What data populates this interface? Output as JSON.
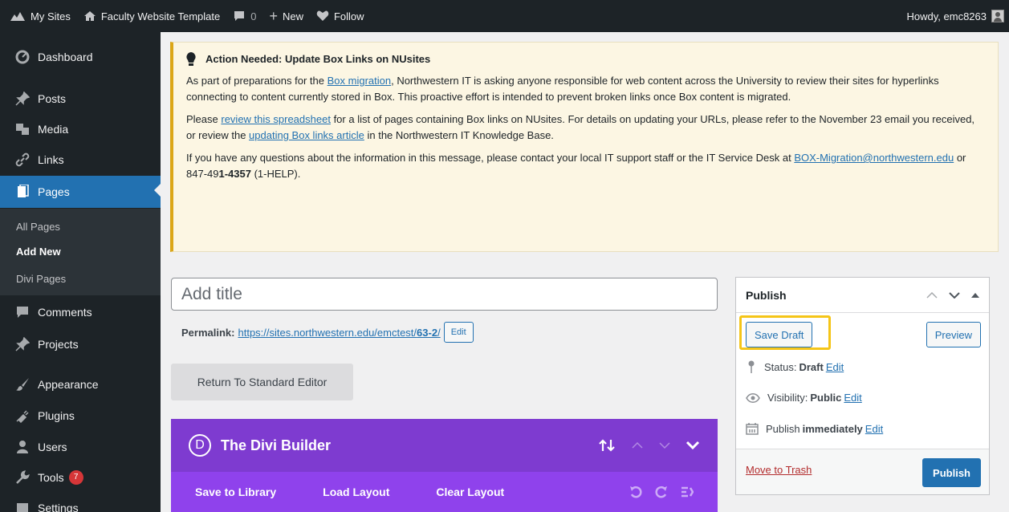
{
  "adminbar": {
    "my_sites": "My Sites",
    "site_name": "Faculty Website Template",
    "comments_count": "0",
    "new_label": "New",
    "follow_label": "Follow",
    "howdy": "Howdy, emc8263"
  },
  "sidebar": {
    "items": [
      {
        "label": "Dashboard",
        "icon": "dashboard-icon"
      },
      {
        "label": "Posts",
        "icon": "pin-icon"
      },
      {
        "label": "Media",
        "icon": "media-icon"
      },
      {
        "label": "Links",
        "icon": "link-icon"
      },
      {
        "label": "Pages",
        "icon": "page-icon"
      },
      {
        "label": "Comments",
        "icon": "comment-icon"
      },
      {
        "label": "Projects",
        "icon": "pin-icon"
      },
      {
        "label": "Appearance",
        "icon": "brush-icon"
      },
      {
        "label": "Plugins",
        "icon": "plugin-icon"
      },
      {
        "label": "Users",
        "icon": "user-icon"
      },
      {
        "label": "Tools",
        "icon": "wrench-icon",
        "badge": "7"
      },
      {
        "label": "Settings",
        "icon": "settings-icon"
      }
    ],
    "submenu": [
      "All Pages",
      "Add New",
      "Divi Pages"
    ]
  },
  "notice": {
    "title": "Action Needed: Update Box Links on NUsites",
    "p1_a": "As part of preparations for the ",
    "p1_link": "Box migration",
    "p1_b": ", Northwestern IT is asking anyone responsible for web content across the University to review their sites for hyperlinks connecting to content currently stored in Box. This proactive effort is intended to prevent broken links once Box content is migrated.",
    "p2_a": "Please ",
    "p2_link1": "review this spreadsheet",
    "p2_b": " for a list of pages containing Box links on NUsites. For details on updating your URLs, please refer to the November 23 email you received, or review the ",
    "p2_link2": "updating Box links article",
    "p2_c": " in the Northwestern IT Knowledge Base.",
    "p3_a": "If you have any questions about the information in this message, please contact your local IT support staff or the IT Service Desk at ",
    "p3_link": "BOX-Migration@northwestern.edu",
    "p3_b": " or 847-49",
    "p3_bold": "1-4357",
    "p3_c": " (1-HELP)."
  },
  "editor": {
    "title_placeholder": "Add title",
    "permalink_label": "Permalink:",
    "permalink_url": "https://sites.northwestern.edu/emctest/",
    "permalink_slug": "63-2",
    "permalink_end": "/",
    "edit_label": "Edit",
    "std_editor_label": "Return To Standard Editor"
  },
  "divi": {
    "logo_letter": "D",
    "title": "The Divi Builder",
    "bar": [
      "Save to Library",
      "Load Layout",
      "Clear Layout"
    ]
  },
  "publish": {
    "title": "Publish",
    "save_draft": "Save Draft",
    "preview": "Preview",
    "status_label": "Status:",
    "status_value": "Draft",
    "visibility_label": "Visibility:",
    "visibility_value": "Public",
    "publish_label": "Publish",
    "publish_value": "immediately",
    "edit": "Edit",
    "trash": "Move to Trash",
    "publish_button": "Publish"
  },
  "colors": {
    "admin_dark": "#1d2327",
    "accent_blue": "#2271b1",
    "notice_bg": "#fcf6e3",
    "notice_border": "#dba617",
    "divi_purple": "#7e3bd0",
    "highlight": "#f5c518",
    "trash_red": "#b32d2e"
  }
}
